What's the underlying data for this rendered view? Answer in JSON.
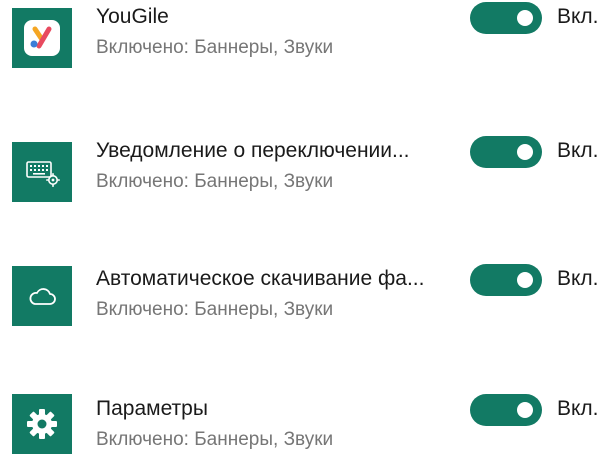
{
  "colors": {
    "accent": "#127a64",
    "secondary_text": "#767676"
  },
  "apps": [
    {
      "title": "YouGile",
      "status": "Включено: Баннеры, Звуки",
      "icon": "yougile-logo-icon",
      "toggle_label": "Вкл.",
      "enabled": true
    },
    {
      "title": "Уведомление о переключении...",
      "status": "Включено: Баннеры, Звуки",
      "icon": "keyboard-settings-icon",
      "toggle_label": "Вкл.",
      "enabled": true
    },
    {
      "title": "Автоматическое скачивание фа...",
      "status": "Включено: Баннеры, Звуки",
      "icon": "cloud-icon",
      "toggle_label": "Вкл.",
      "enabled": true
    },
    {
      "title": "Параметры",
      "status": "Включено: Баннеры, Звуки",
      "icon": "gear-icon",
      "toggle_label": "Вкл.",
      "enabled": true
    }
  ]
}
